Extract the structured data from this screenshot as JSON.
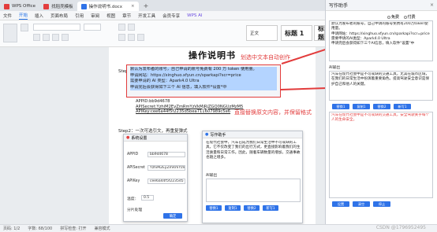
{
  "titlebar": {
    "tabs": [
      {
        "label": "WPS Office",
        "color": "#e33d3d"
      },
      {
        "label": "找稻壳模板",
        "color": "#e33d3d"
      },
      {
        "label": "操作说明书.docx",
        "color": "#2f73e8"
      }
    ]
  },
  "menubar": {
    "items": [
      "文件",
      "开始",
      "插入",
      "页面布局",
      "引用",
      "审阅",
      "视图",
      "章节",
      "开发工具",
      "会员专享",
      "WPS AI"
    ]
  },
  "toolbar": {
    "style_normal": "正文",
    "style_h1": "标题 1",
    "style_h2": "标题"
  },
  "document": {
    "title": "操作说明书",
    "step1": "Step1:",
    "code_lines": [
      "默认为发布者的账号，自己申请的账号免费有 200 万 token 使用量。",
      "申请网站：https://xinghuo.xfyun.cn/sparkapi?scr=price",
      "需要申请的 AI 类型：Apark4.0 Ultra",
      "申请完后会获得如下三个 AI 信息，填入软件*设置*中"
    ],
    "api_lines": [
      "APPID:bb9d4678",
      "APISecret:YzhiM2EyZmRmYzVkMjRjZGQ0NGUzMzM5",
      "APIKey:cee6a44f5f2235d5bea711607989c5e6"
    ],
    "step2": "Step2：一次可选引文，再重复弹式"
  },
  "annotations": {
    "top": "划选中文本自动创作",
    "bottom": "直接替换原文内容，并保留格式"
  },
  "settings_dialog": {
    "title": "系统设置",
    "fields": [
      {
        "label": "APPID",
        "value": "bb9d4678"
      },
      {
        "label": "APISecret",
        "value": "YzhiM2EyZmRmYzVk"
      },
      {
        "label": "APIKey",
        "value": "cee6a44f5f2235d5"
      }
    ],
    "temp_label": "温度：",
    "temp_value": "0.5",
    "section_label": "分片处理",
    "confirm": "确定"
  },
  "assistant_dialog": {
    "title": "写作助手",
    "content": "在现代社会中，汽车已成为我们日常生活中不可或缺的工具，它不仅改变了我们的出行方式，更直接影响着我们的生活质量和日常工作。因此，随着车辆数量的增加，交通事故也随之增多。",
    "label_ai": "AI输出",
    "btn_replace": "替换1",
    "btn_copy": "复制1",
    "btn_append": "替换2",
    "btn_new": "新写1"
  },
  "panel": {
    "title": "写作助手",
    "mode_free": "免费",
    "mode_paid": "付费",
    "header_text": "默认为发布者的账号，自己申请的账号免费有200万token使用量。",
    "site_text": "申请网站：https://xinghuo.xfyun.cn/sparkapi?scr=price",
    "type_text": "需要申请的AI类型：Apark4.0 Ultra",
    "after_text": "申请完后会获得如下三个AI信息，填入软件\"设置\"中",
    "ai_output_label": "AI输出",
    "output_text": "汽车在现代社会中是不可或缺的交通工具，尤其在城市区域，在我们的日常生活中扮演着重要角色。提高驾驶安全意识是保护自己和他人的关键。",
    "red_text": "汽车在现代社会中是不可或缺的交通工具，安全驾驶关乎每个人的生命安全。",
    "btn_replace1": "替换1",
    "btn_copy1": "复制1",
    "btn_replace2": "替换2",
    "btn_new": "新写1",
    "btn_set": "设置",
    "btn_clear": "清空",
    "btn_stop": "停止"
  },
  "statusbar": {
    "page": "页码: 1/2",
    "words": "字数: 68/100",
    "spell": "拼写检查: 打开",
    "mode": "兼容模式"
  },
  "watermark": "CSDN @1796952495"
}
